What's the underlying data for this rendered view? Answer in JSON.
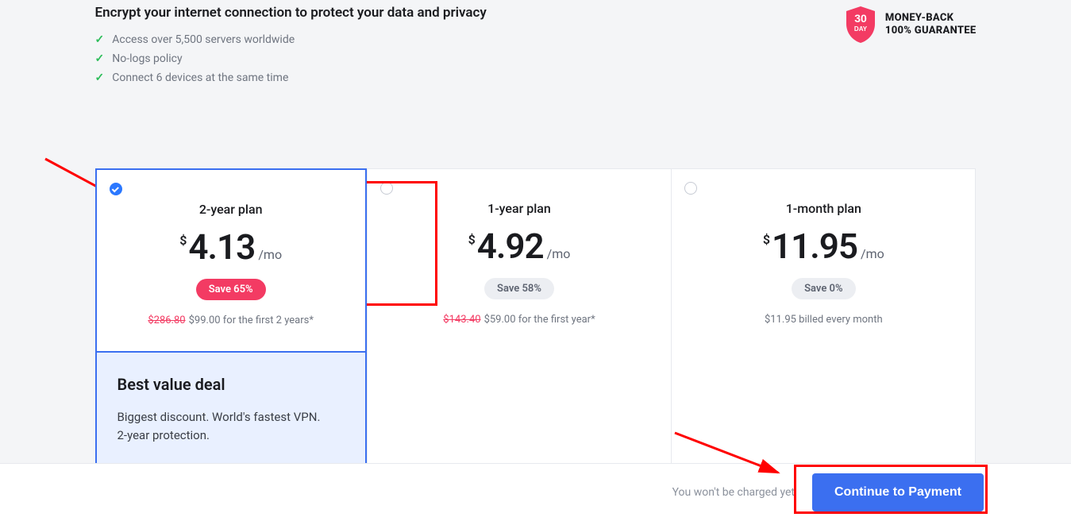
{
  "header": {
    "subtitle": "Encrypt your internet connection to protect your data and privacy",
    "features": [
      "Access over 5,500 servers worldwide",
      "No-logs policy",
      "Connect 6 devices at the same time"
    ]
  },
  "guarantee": {
    "badge_top": "30",
    "badge_bottom": "DAY",
    "line1": "MONEY-BACK",
    "line2": "100% GUARANTEE"
  },
  "plans": [
    {
      "name": "2-year plan",
      "currency": "$",
      "price": "4.13",
      "per": "/mo",
      "save_label": "Save 65%",
      "save_hot": true,
      "strike": "$286.80",
      "fineprint": "$99.00 for the first 2 years*",
      "selected": true
    },
    {
      "name": "1-year plan",
      "currency": "$",
      "price": "4.92",
      "per": "/mo",
      "save_label": "Save 58%",
      "save_hot": false,
      "strike": "$143.40",
      "fineprint": "$59.00 for the first year*",
      "selected": false
    },
    {
      "name": "1-month plan",
      "currency": "$",
      "price": "11.95",
      "per": "/mo",
      "save_label": "Save 0%",
      "save_hot": false,
      "strike": "",
      "fineprint": "$11.95 billed every month",
      "selected": false
    }
  ],
  "best_value": {
    "title": "Best value deal",
    "desc": "Biggest discount. World's fastest VPN. 2-year protection."
  },
  "footer": {
    "note": "You won't be charged yet",
    "cta": "Continue to Payment"
  }
}
